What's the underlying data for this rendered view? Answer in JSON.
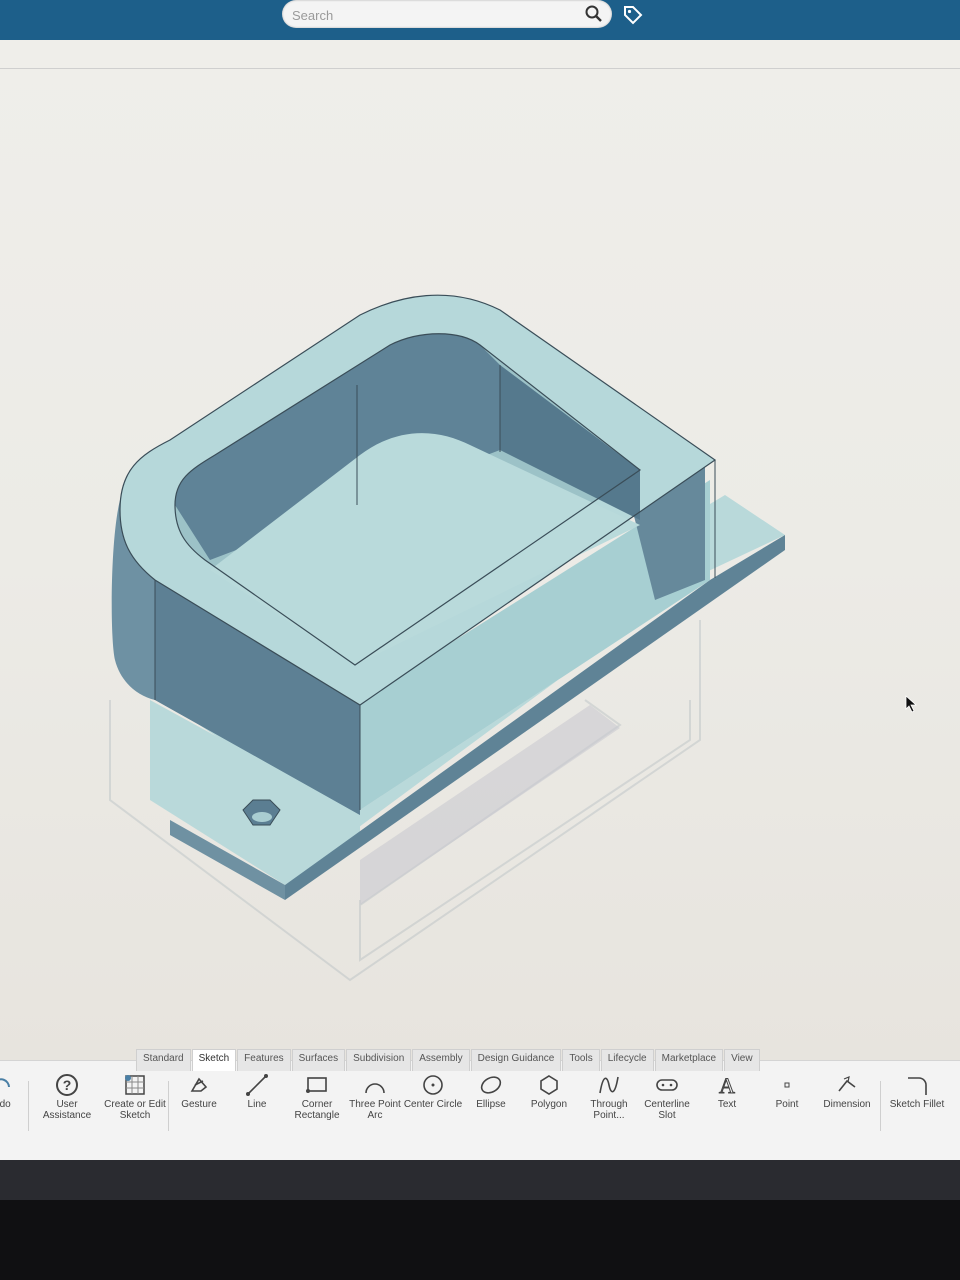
{
  "search": {
    "placeholder": "Search"
  },
  "tabs": [
    "Standard",
    "Sketch",
    "Features",
    "Surfaces",
    "Subdivision",
    "Assembly",
    "Design Guidance",
    "Tools",
    "Lifecycle",
    "Marketplace",
    "View"
  ],
  "tools": {
    "undo": "...do",
    "user_assistance": "User Assistance",
    "create_sketch": "Create or Edit Sketch",
    "gesture": "Gesture",
    "line": "Line",
    "corner_rectangle": "Corner Rectangle",
    "three_point_arc": "Three Point Arc",
    "center_circle": "Center Circle",
    "ellipse": "Ellipse",
    "polygon": "Polygon",
    "through_point": "Through Point...",
    "centerline_slot": "Centerline Slot",
    "text": "Text",
    "point": "Point",
    "dimension": "Dimension",
    "sketch_fillet": "Sketch Fillet"
  },
  "colors": {
    "header": "#1d5f8a",
    "model_top": "#b8dadb",
    "model_side_dark": "#5c7f92",
    "model_side_mid": "#7fa6b4"
  }
}
